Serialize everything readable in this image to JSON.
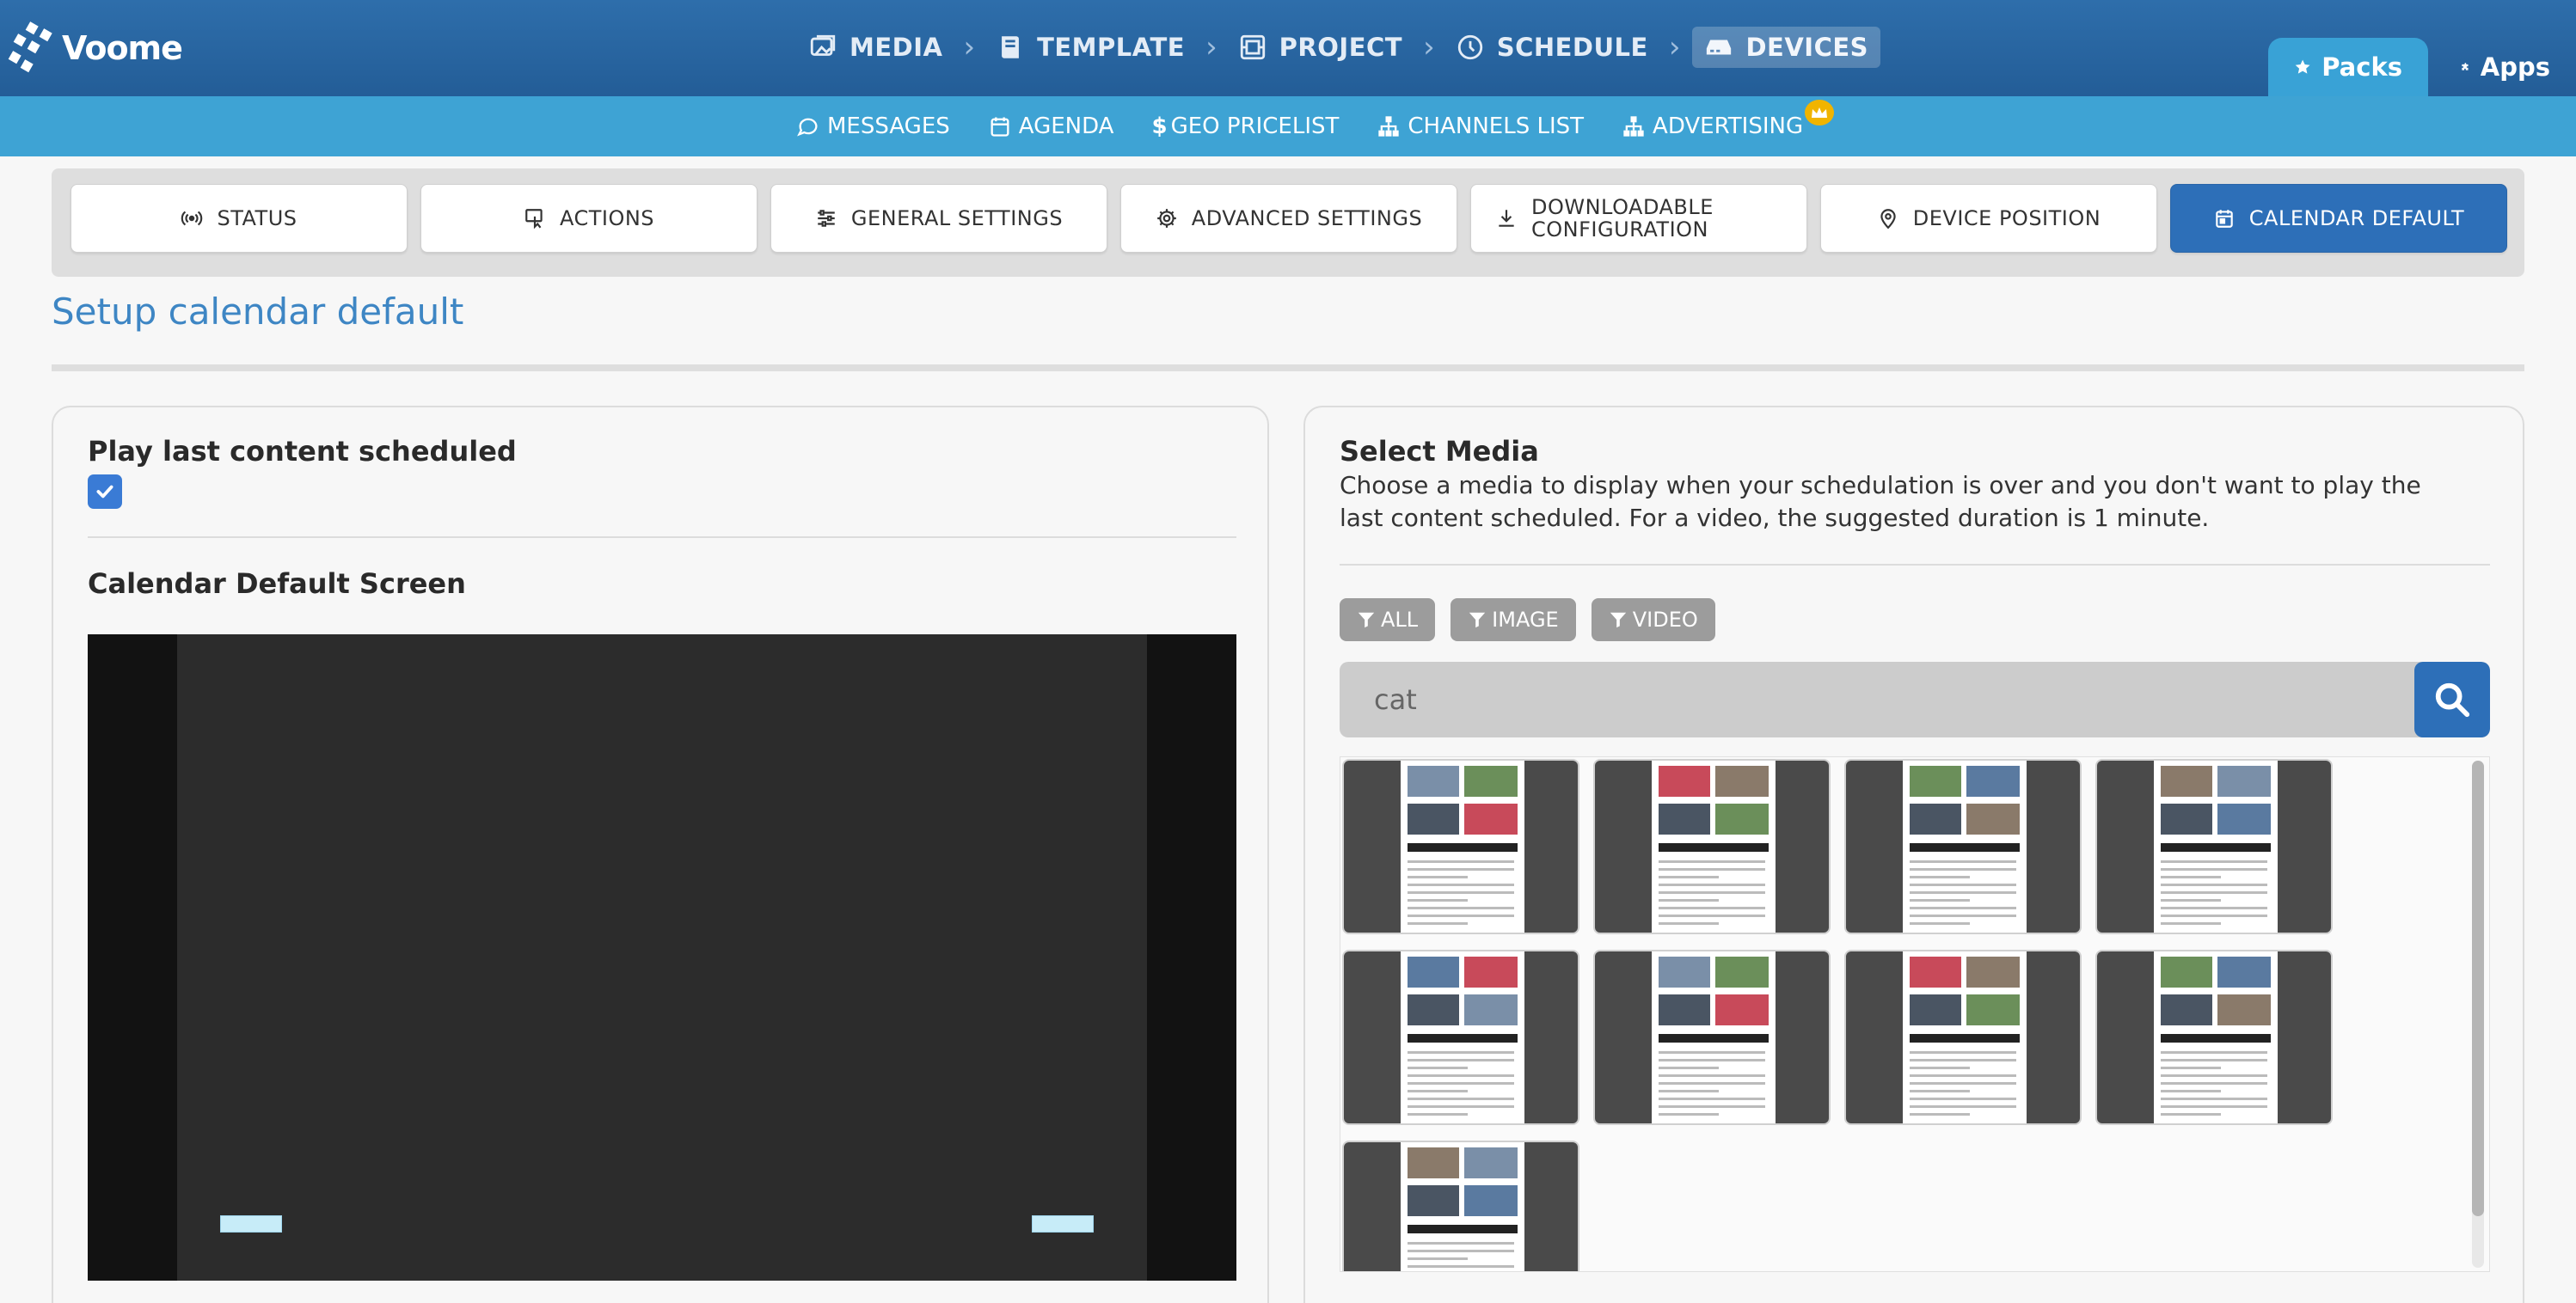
{
  "app": {
    "name": "Voome"
  },
  "breadcrumb": [
    {
      "label": "MEDIA",
      "icon": "image-icon"
    },
    {
      "label": "TEMPLATE",
      "icon": "book-icon"
    },
    {
      "label": "PROJECT",
      "icon": "frame-icon"
    },
    {
      "label": "SCHEDULE",
      "icon": "clock-icon"
    },
    {
      "label": "DEVICES",
      "icon": "device-icon",
      "active": true
    }
  ],
  "right_tabs": [
    {
      "label": "Packs",
      "icon": "star-icon",
      "active": true
    },
    {
      "label": "Apps",
      "icon": "puzzle-icon"
    }
  ],
  "subnav": [
    {
      "label": "MESSAGES",
      "icon": "chat-icon"
    },
    {
      "label": "AGENDA",
      "icon": "calendar-icon"
    },
    {
      "label": "GEO PRICELIST",
      "icon": "dollar-icon"
    },
    {
      "label": "CHANNELS LIST",
      "icon": "sitemap-icon"
    },
    {
      "label": "ADVERTISING",
      "icon": "sitemap-icon",
      "badge": "crown-icon"
    }
  ],
  "settings_tabs": [
    {
      "label": "STATUS",
      "icon": "broadcast-icon"
    },
    {
      "label": "ACTIONS",
      "icon": "remote-icon"
    },
    {
      "label": "GENERAL SETTINGS",
      "icon": "sliders-icon"
    },
    {
      "label": "ADVANCED SETTINGS",
      "icon": "gear-icon"
    },
    {
      "label": "DOWNLOADABLE",
      "label2": "CONFIGURATION",
      "icon": "download-icon"
    },
    {
      "label": "DEVICE POSITION",
      "icon": "pin-icon"
    },
    {
      "label": "CALENDAR DEFAULT",
      "icon": "calendar-icon",
      "active": true
    }
  ],
  "page": {
    "title": "Setup calendar default"
  },
  "left_card": {
    "play_last_label": "Play last content scheduled",
    "play_last_checked": true,
    "default_screen_label": "Calendar Default Screen"
  },
  "right_card": {
    "title": "Select Media",
    "description": "Choose a media to display when your schedulation is over and you don't want to play the last content scheduled. For a video, the suggested duration is 1 minute.",
    "filters": [
      "ALL",
      "IMAGE",
      "VIDEO"
    ],
    "search": {
      "value": "cat"
    },
    "media_count": 9
  },
  "colors": {
    "topbar": "#2a66a2",
    "subnav": "#3ea3d4",
    "accent": "#2d6fb8",
    "title": "#3e86c4",
    "packs_tab": "#39a2d6"
  }
}
